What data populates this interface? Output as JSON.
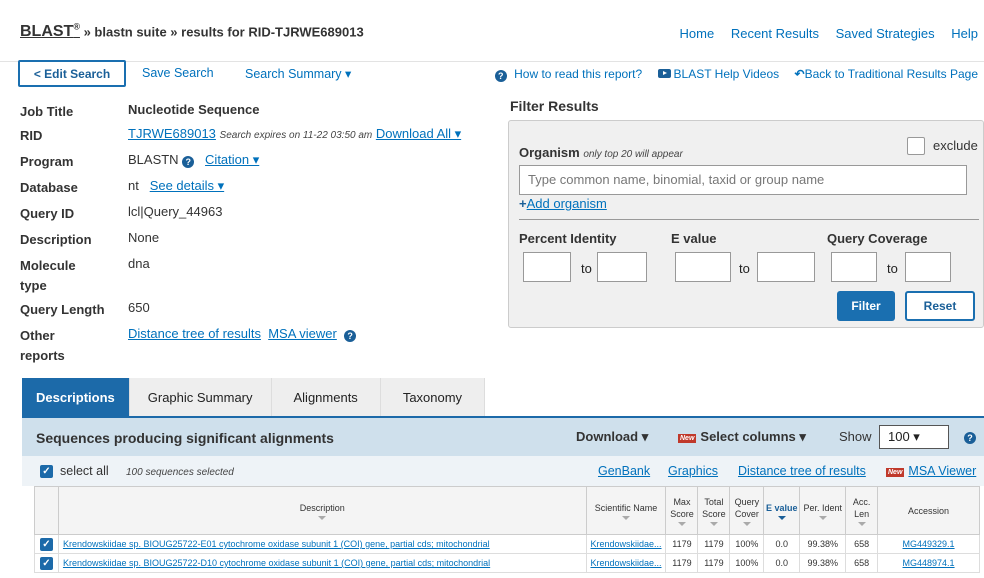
{
  "header": {
    "blast": "BLAST",
    "registered": "®",
    "crumb_suite": "» blastn suite",
    "crumb_results": "» results for RID-TJRWE689013",
    "links": [
      "Home",
      "Recent Results",
      "Saved Strategies",
      "Help"
    ]
  },
  "subnav": {
    "edit_search": "< Edit Search",
    "save_search": "Save Search",
    "search_summary": "Search Summary ▾",
    "how_to_read": "How to read this report?",
    "help_videos": "BLAST Help Videos",
    "back_traditional": "Back to Traditional Results Page"
  },
  "job": {
    "job_title_label": "Job Title",
    "job_title": "Nucleotide Sequence",
    "rid_label": "RID",
    "rid": "TJRWE689013",
    "rid_expires": "Search expires on 11-22 03:50 am",
    "download_all": "Download All ▾",
    "program_label": "Program",
    "program": "BLASTN",
    "citation": "Citation ▾",
    "database_label": "Database",
    "database": "nt",
    "see_details": "See details ▾",
    "query_id_label": "Query ID",
    "query_id": "lcl|Query_44963",
    "description_label": "Description",
    "description": "None",
    "molecule_label": "Molecule type",
    "molecule": "dna",
    "query_length_label": "Query Length",
    "query_length": "650",
    "other_reports_label": "Other reports",
    "distance_tree": "Distance tree of results",
    "msa_viewer": "MSA viewer"
  },
  "filter": {
    "title": "Filter Results",
    "organism_label": "Organism",
    "organism_note": "only top 20 will appear",
    "exclude": "exclude",
    "organism_placeholder": "Type common name, binomial, taxid or group name",
    "add_organism": "Add organism",
    "percent_identity": "Percent Identity",
    "e_value": "E value",
    "query_coverage": "Query Coverage",
    "to": "to",
    "filter_btn": "Filter",
    "reset_btn": "Reset"
  },
  "tabs": [
    "Descriptions",
    "Graphic Summary",
    "Alignments",
    "Taxonomy"
  ],
  "results": {
    "title": "Sequences producing significant alignments",
    "download": "Download ▾",
    "new_badge": "New",
    "select_columns": "Select columns ▾",
    "show": "Show",
    "show_value": "100 ▾",
    "select_all": "select all",
    "selected_count": "100 sequences selected",
    "genbank": "GenBank",
    "graphics": "Graphics",
    "distance_tree": "Distance tree of results",
    "msa_viewer": "MSA Viewer",
    "columns": {
      "description": "Description",
      "scientific_name": "Scientific Name",
      "max_score": "Max Score",
      "total_score": "Total Score",
      "query_cover": "Query Cover",
      "e_value": "E value",
      "per_ident": "Per. Ident",
      "acc_len": "Acc. Len",
      "accession": "Accession"
    },
    "rows": [
      {
        "description": "Krendowskiidae sp. BIOUG25722-E01 cytochrome oxidase subunit 1 (COI) gene, partial cds; mitochondrial",
        "scientific_name": "Krendowskiidae...",
        "max_score": "1179",
        "total_score": "1179",
        "query_cover": "100%",
        "e_value": "0.0",
        "per_ident": "99.38%",
        "acc_len": "658",
        "accession": "MG449329.1"
      },
      {
        "description": "Krendowskiidae sp. BIOUG25722-D10 cytochrome oxidase subunit 1 (COI) gene, partial cds; mitochondrial",
        "scientific_name": "Krendowskiidae...",
        "max_score": "1179",
        "total_score": "1179",
        "query_cover": "100%",
        "e_value": "0.0",
        "per_ident": "99.38%",
        "acc_len": "658",
        "accession": "MG448974.1"
      }
    ]
  },
  "colors": {
    "accent": "#1c6aa9",
    "link": "#0071bc",
    "result_bar": "#cfe0ec"
  }
}
